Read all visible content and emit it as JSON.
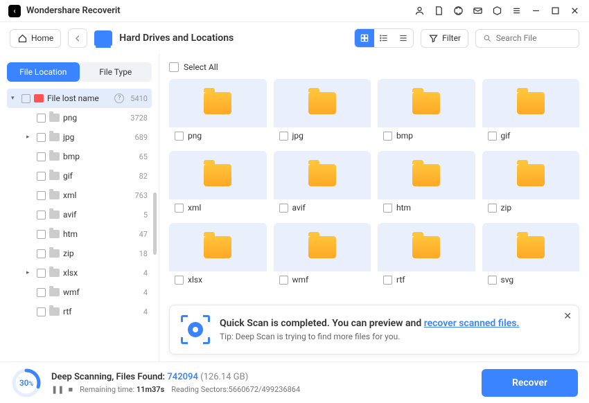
{
  "titlebar": {
    "app_name": "Wondershare Recoverit"
  },
  "toolbar": {
    "home_label": "Home",
    "location_title": "Hard Drives and Locations",
    "filter_label": "Filter",
    "search_placeholder": "Search File"
  },
  "sidebar": {
    "tabs": {
      "file_location": "File Location",
      "file_type": "File Type"
    },
    "root": {
      "label": "File lost name",
      "count": "5410"
    },
    "items": [
      {
        "label": "png",
        "count": "3728",
        "expandable": false
      },
      {
        "label": "jpg",
        "count": "689",
        "expandable": true
      },
      {
        "label": "bmp",
        "count": "65",
        "expandable": false
      },
      {
        "label": "gif",
        "count": "82",
        "expandable": false
      },
      {
        "label": "xml",
        "count": "763",
        "expandable": false
      },
      {
        "label": "avif",
        "count": "5",
        "expandable": false
      },
      {
        "label": "htm",
        "count": "47",
        "expandable": false
      },
      {
        "label": "zip",
        "count": "18",
        "expandable": false
      },
      {
        "label": "xlsx",
        "count": "4",
        "expandable": true
      },
      {
        "label": "wmf",
        "count": "4",
        "expandable": false
      },
      {
        "label": "rtf",
        "count": "4",
        "expandable": false
      }
    ]
  },
  "content": {
    "select_all": "Select All",
    "folders": [
      "png",
      "jpg",
      "bmp",
      "gif",
      "xml",
      "avif",
      "htm",
      "zip",
      "xlsx",
      "wmf",
      "rtf",
      "svg"
    ]
  },
  "banner": {
    "title_prefix": "Quick Scan is completed. You can preview and ",
    "title_link": "recover scanned files.",
    "tip": "Tip: Deep Scan is trying to find more files for you."
  },
  "footer": {
    "progress_pct": "30",
    "status_prefix": "Deep Scanning, Files Found: ",
    "files_found": "742094",
    "size": "(126.14 GB)",
    "remaining_label": "Remaining time:",
    "remaining_value": "11m37s",
    "sectors_label": "Reading Sectors:",
    "sectors_value": "5660672/499236864",
    "recover_label": "Recover"
  }
}
